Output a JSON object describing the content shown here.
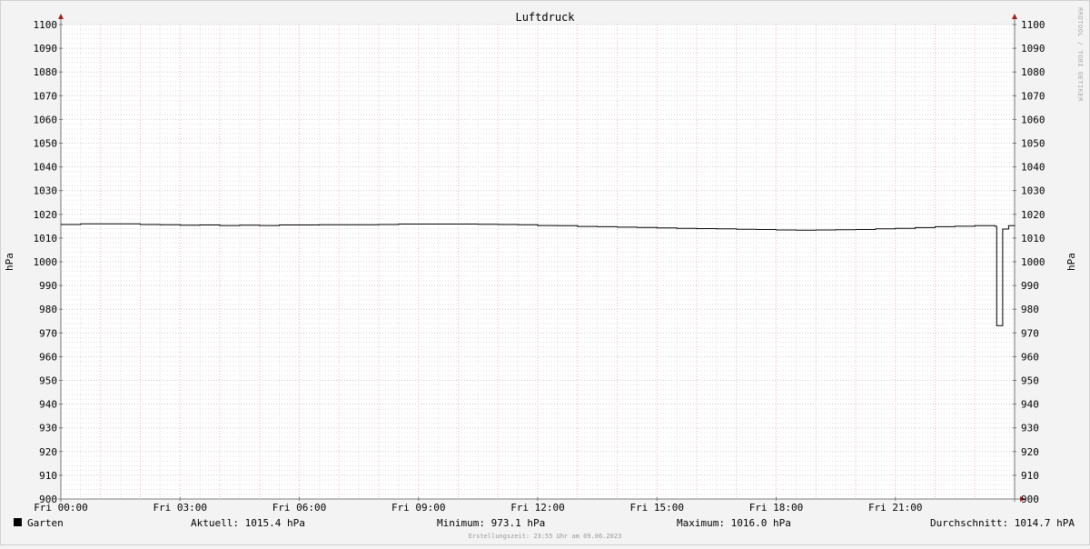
{
  "chart_data": {
    "type": "line",
    "title": "Luftdruck",
    "ylabel": "hPa",
    "ylim": [
      900,
      1100
    ],
    "yticks": [
      900,
      910,
      920,
      930,
      940,
      950,
      960,
      970,
      980,
      990,
      1000,
      1010,
      1020,
      1030,
      1040,
      1050,
      1060,
      1070,
      1080,
      1090,
      1100
    ],
    "xlim": [
      0,
      24
    ],
    "xticks": [
      {
        "x": 0,
        "label": "Fri 00:00"
      },
      {
        "x": 3,
        "label": "Fri 03:00"
      },
      {
        "x": 6,
        "label": "Fri 06:00"
      },
      {
        "x": 9,
        "label": "Fri 09:00"
      },
      {
        "x": 12,
        "label": "Fri 12:00"
      },
      {
        "x": 15,
        "label": "Fri 15:00"
      },
      {
        "x": 18,
        "label": "Fri 18:00"
      },
      {
        "x": 21,
        "label": "Fri 21:00"
      }
    ],
    "grid": true,
    "side_credit": "RRDTOOL / TOBI OETIKER",
    "series": [
      {
        "name": "Garten",
        "color": "#000000",
        "x": [
          0,
          0.5,
          1.0,
          1.5,
          2.0,
          2.5,
          3.0,
          3.5,
          4.0,
          4.5,
          5.0,
          5.5,
          6.0,
          6.5,
          7.0,
          7.5,
          8.0,
          8.5,
          9.0,
          9.5,
          10.0,
          10.5,
          11.0,
          11.5,
          12.0,
          12.5,
          13.0,
          13.5,
          14.0,
          14.5,
          15.0,
          15.5,
          16.0,
          16.5,
          17.0,
          17.5,
          18.0,
          18.5,
          19.0,
          19.5,
          20.0,
          20.5,
          21.0,
          21.5,
          22.0,
          22.5,
          23.0,
          23.5,
          23.55,
          23.6,
          23.7,
          23.85,
          24.0
        ],
        "y": [
          1015.7,
          1016.0,
          1016.0,
          1016.0,
          1015.7,
          1015.6,
          1015.4,
          1015.5,
          1015.3,
          1015.4,
          1015.3,
          1015.5,
          1015.5,
          1015.6,
          1015.6,
          1015.6,
          1015.7,
          1015.9,
          1015.9,
          1015.9,
          1015.9,
          1015.8,
          1015.7,
          1015.6,
          1015.3,
          1015.2,
          1014.9,
          1014.8,
          1014.6,
          1014.5,
          1014.3,
          1014.1,
          1014.0,
          1013.9,
          1013.7,
          1013.6,
          1013.4,
          1013.3,
          1013.4,
          1013.5,
          1013.6,
          1013.9,
          1014.1,
          1014.4,
          1014.8,
          1015.0,
          1015.2,
          1015.0,
          973.1,
          973.1,
          1013.8,
          1015.2,
          1015.4
        ]
      }
    ],
    "legend": {
      "name": "Garten",
      "current": "Aktuell: 1015.4 hPa",
      "minimum": "Minimum: 973.1 hPa",
      "maximum": "Maximum: 1016.0 hPa",
      "average": "Durchschnitt: 1014.7 hPA"
    },
    "footer": "Erstellungszeit: 23:55 Uhr am 09.06.2023"
  }
}
